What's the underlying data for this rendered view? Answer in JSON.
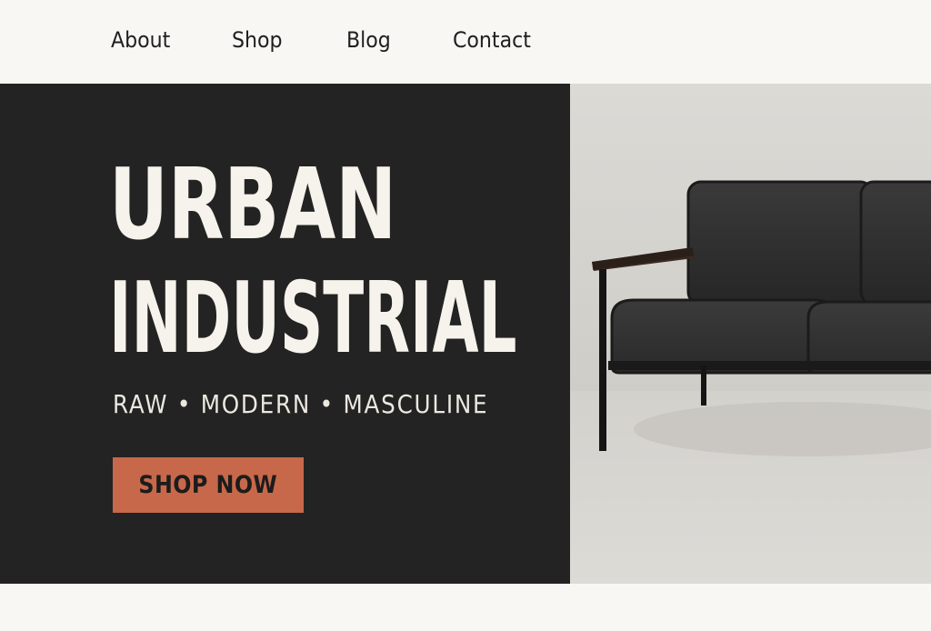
{
  "nav": {
    "items": [
      {
        "label": "About"
      },
      {
        "label": "Shop"
      },
      {
        "label": "Blog"
      },
      {
        "label": "Contact"
      }
    ]
  },
  "hero": {
    "title_line1": "URBAN",
    "title_line2": "INDUSTRIAL",
    "tagline": "RAW • MODERN • MASCULINE",
    "cta_label": "SHOP NOW"
  },
  "photo": {
    "subject": "black-sofa-image"
  },
  "colors": {
    "background": "#f8f7f3",
    "hero_dark": "#232323",
    "accent": "#c8684a",
    "text_light": "#f6f3ec",
    "text_dark": "#1f1f1f"
  }
}
